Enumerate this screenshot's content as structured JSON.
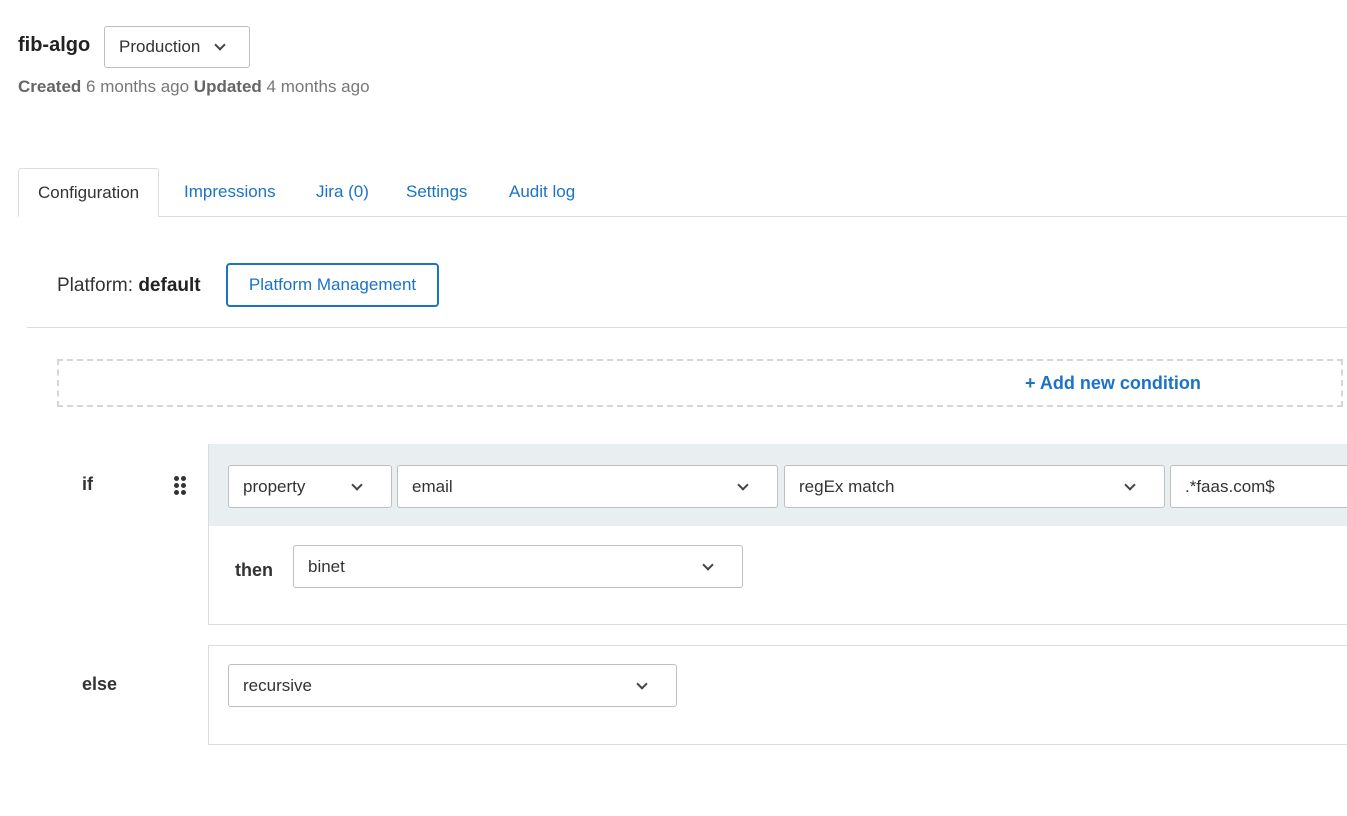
{
  "header": {
    "flag_name": "fib-algo",
    "environment": "Production",
    "created_label": "Created",
    "created_value": "6 months ago",
    "updated_label": "Updated",
    "updated_value": "4 months ago"
  },
  "tabs": [
    {
      "label": "Configuration",
      "active": true
    },
    {
      "label": "Impressions",
      "active": false
    },
    {
      "label": "Jira (0)",
      "active": false
    },
    {
      "label": "Settings",
      "active": false
    },
    {
      "label": "Audit log",
      "active": false
    }
  ],
  "platform": {
    "label": "Platform:",
    "value": "default",
    "button_label": "Platform Management"
  },
  "add_condition_label": "+ Add new condition",
  "rule": {
    "if_label": "if",
    "type_select": "property",
    "property_select": "email",
    "operator_select": "regEx match",
    "value_input": ".*faas.com$",
    "then_label": "then",
    "then_select": "binet"
  },
  "else": {
    "label": "else",
    "select": "recursive"
  },
  "colors": {
    "accent": "#1a73c7",
    "condition_bar": "#e9eef1"
  },
  "icons": {
    "dropdown": "chevron-down-icon",
    "drag": "drag-handle-icon"
  }
}
